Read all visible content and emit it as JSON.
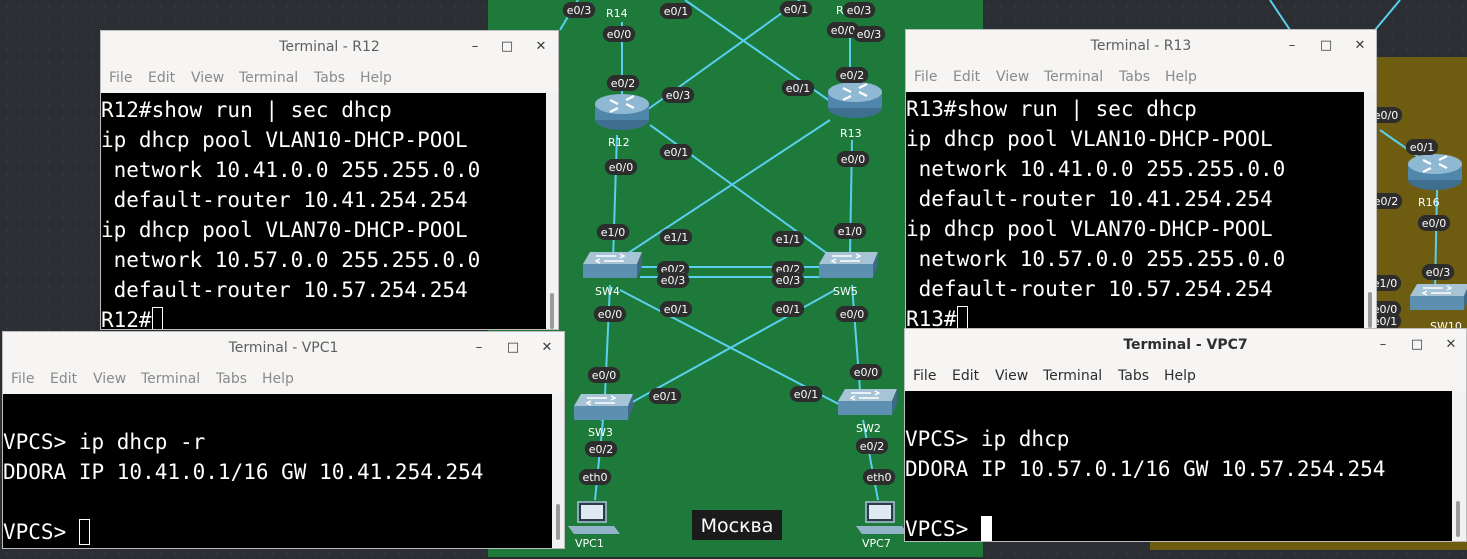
{
  "canvas": {
    "background": "#2b2f33",
    "moscow_zone_color": "#1d7a3a",
    "other_zone_color": "#6e5c10",
    "link_color": "#5ad0f0",
    "location_label": "Москва",
    "devices": [
      {
        "name": "R14",
        "icon": "router-icon"
      },
      {
        "name": "R15",
        "icon": "router-icon"
      },
      {
        "name": "R12",
        "icon": "router-icon"
      },
      {
        "name": "R13",
        "icon": "router-icon"
      },
      {
        "name": "R16",
        "icon": "router-icon"
      },
      {
        "name": "SW4",
        "icon": "switch-icon"
      },
      {
        "name": "SW5",
        "icon": "switch-icon"
      },
      {
        "name": "SW3",
        "icon": "switch-icon"
      },
      {
        "name": "SW2",
        "icon": "switch-icon"
      },
      {
        "name": "SW10",
        "icon": "switch-icon"
      },
      {
        "name": "VPC1",
        "icon": "pc-icon"
      },
      {
        "name": "VPC7",
        "icon": "pc-icon"
      }
    ],
    "port_labels": [
      "e0/3",
      "e0/1",
      "e0/1",
      "e0/3",
      "e0/0",
      "e0/0",
      "e0/2",
      "e0/3",
      "e0/3",
      "e0/2",
      "e0/1",
      "e0/1",
      "e0/0",
      "e0/0",
      "e1/0",
      "e1/1",
      "e1/1",
      "e1/0",
      "e0/2",
      "e0/2",
      "e0/3",
      "e0/3",
      "e0/1",
      "e0/1",
      "e0/0",
      "e0/0",
      "e0/0",
      "e0/1",
      "e0/1",
      "e0/0",
      "e0/2",
      "e0/2",
      "eth0",
      "eth0",
      "e0/0",
      "e0/1",
      "e0/2",
      "e0/0",
      "e0/3",
      "e1/0",
      "e0/0",
      "e0/1"
    ]
  },
  "windows": {
    "r12": {
      "title": "Terminal - R12",
      "menu": [
        "File",
        "Edit",
        "View",
        "Terminal",
        "Tabs",
        "Help"
      ],
      "lines": [
        "R12#show run | sec dhcp",
        "ip dhcp pool VLAN10-DHCP-POOL",
        " network 10.41.0.0 255.255.0.0",
        " default-router 10.41.254.254",
        "ip dhcp pool VLAN70-DHCP-POOL",
        " network 10.57.0.0 255.255.0.0",
        " default-router 10.57.254.254"
      ],
      "prompt": "R12#"
    },
    "r13": {
      "title": "Terminal - R13",
      "menu": [
        "File",
        "Edit",
        "View",
        "Terminal",
        "Tabs",
        "Help"
      ],
      "lines": [
        "R13#show run | sec dhcp",
        "ip dhcp pool VLAN10-DHCP-POOL",
        " network 10.41.0.0 255.255.0.0",
        " default-router 10.41.254.254",
        "ip dhcp pool VLAN70-DHCP-POOL",
        " network 10.57.0.0 255.255.0.0",
        " default-router 10.57.254.254"
      ],
      "prompt": "R13#"
    },
    "vpc1": {
      "title": "Terminal - VPC1",
      "menu": [
        "File",
        "Edit",
        "View",
        "Terminal",
        "Tabs",
        "Help"
      ],
      "lines": [
        "VPCS> ip dhcp -r",
        "DDORA IP 10.41.0.1/16 GW 10.41.254.254"
      ],
      "prompt": "VPCS> "
    },
    "vpc7": {
      "title": "Terminal - VPC7",
      "menu": [
        "File",
        "Edit",
        "View",
        "Terminal",
        "Tabs",
        "Help"
      ],
      "lines": [
        "VPCS> ip dhcp",
        "DDORA IP 10.57.0.1/16 GW 10.57.254.254"
      ],
      "prompt": "VPCS> "
    }
  }
}
